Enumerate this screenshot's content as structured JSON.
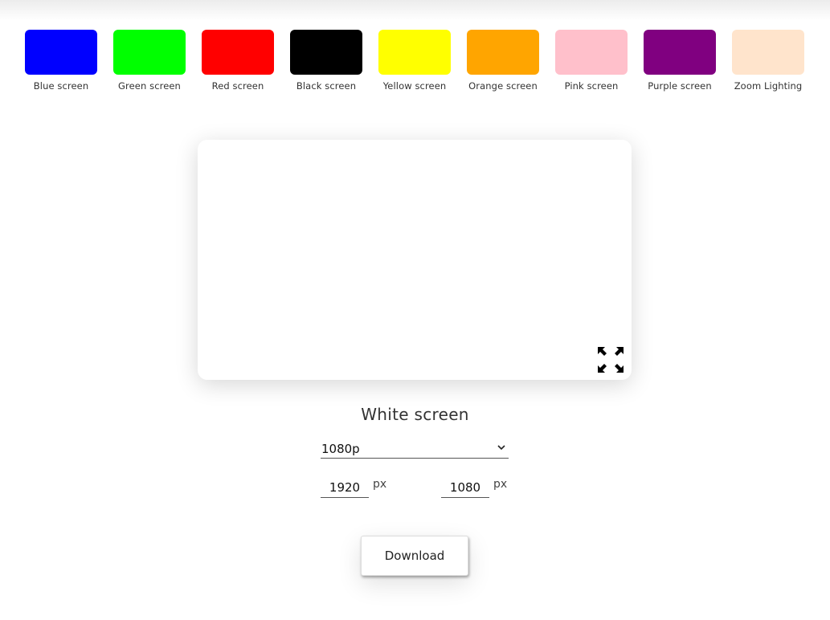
{
  "swatches": [
    {
      "label": "Blue screen",
      "color": "#0000ff"
    },
    {
      "label": "Green screen",
      "color": "#00ff00"
    },
    {
      "label": "Red screen",
      "color": "#ff0000"
    },
    {
      "label": "Black screen",
      "color": "#000000"
    },
    {
      "label": "Yellow screen",
      "color": "#ffff00"
    },
    {
      "label": "Orange screen",
      "color": "#ffa500"
    },
    {
      "label": "Pink screen",
      "color": "#ffc0cb"
    },
    {
      "label": "Purple screen",
      "color": "#800080"
    },
    {
      "label": "Zoom Lighting",
      "color": "#ffe4cc"
    }
  ],
  "preview": {
    "color": "#ffffff",
    "fullscreen_icon": "expand-arrows-icon"
  },
  "title": "White screen",
  "resolution": {
    "selected": "1080p",
    "chevron": "⌄"
  },
  "width": {
    "value": "1920",
    "unit": "px"
  },
  "height": {
    "value": "1080",
    "unit": "px"
  },
  "download_label": "Download"
}
